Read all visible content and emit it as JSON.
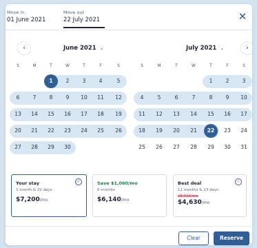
{
  "header": {
    "move_in_label": "Move in",
    "move_in_value": "01 June 2021",
    "move_out_label": "Move out",
    "move_out_value": "22 July 2021"
  },
  "icons": {
    "close": "close-icon",
    "prev": "chevron-left-icon",
    "next": "chevron-right-icon"
  },
  "nav": {
    "prev_glyph": "‹",
    "next_glyph": "›",
    "close_glyph": "✕",
    "chevron_glyph": "⌄"
  },
  "weekdays": [
    "S",
    "M",
    "T",
    "W",
    "T",
    "F",
    "S"
  ],
  "calendars": [
    {
      "month": "June 2021",
      "weeks": [
        [
          "",
          "",
          "1",
          "2",
          "3",
          "4",
          "5"
        ],
        [
          "6",
          "7",
          "8",
          "9",
          "10",
          "11",
          "12"
        ],
        [
          "13",
          "14",
          "15",
          "16",
          "17",
          "18",
          "19"
        ],
        [
          "20",
          "21",
          "22",
          "23",
          "24",
          "25",
          "26"
        ],
        [
          "27",
          "28",
          "29",
          "30",
          "",
          "",
          ""
        ]
      ],
      "selected_day": "1"
    },
    {
      "month": "July 2021",
      "weeks": [
        [
          "",
          "",
          "",
          "",
          "1",
          "2",
          "3"
        ],
        [
          "4",
          "5",
          "6",
          "7",
          "8",
          "9",
          "10"
        ],
        [
          "11",
          "12",
          "13",
          "14",
          "15",
          "16",
          "17"
        ],
        [
          "18",
          "19",
          "20",
          "21",
          "22",
          "23",
          "24"
        ],
        [
          "25",
          "26",
          "27",
          "28",
          "29",
          "30",
          "31"
        ]
      ],
      "selected_day": "22"
    }
  ],
  "plans": [
    {
      "title": "Your stay",
      "subtitle": "1 month & 22 days",
      "price": "$7,200",
      "per": "/mo",
      "icon_glyph": "✓"
    },
    {
      "title": "Save $1,060/mo",
      "subtitle": "6 months",
      "price": "$6,140",
      "per": "/mo"
    },
    {
      "title": "Best deal",
      "subtitle": "11 months & 23 days",
      "old_price": "$5,916/mo",
      "price": "$4,630",
      "per": "/mo",
      "icon_glyph": "i"
    }
  ],
  "footer": {
    "clear_label": "Clear",
    "reserve_label": "Reserve"
  },
  "colors": {
    "accent": "#2f5f96",
    "range": "#d7e6f4",
    "savings": "#1f7a4a",
    "strike": "#c43b3b",
    "backdrop": "#d3e3f0"
  }
}
